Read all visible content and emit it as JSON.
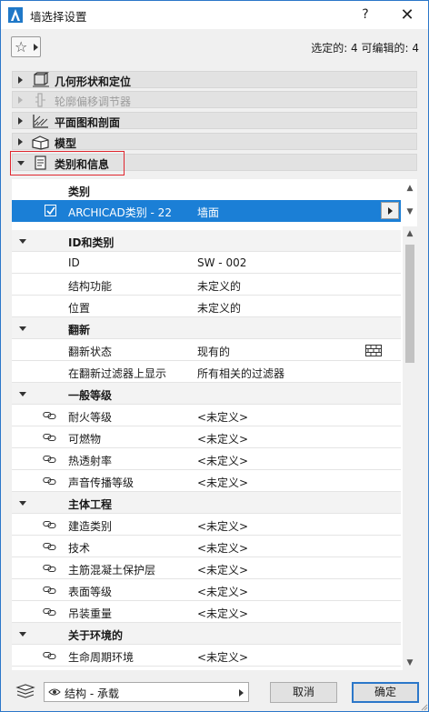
{
  "window": {
    "title": "墙选择设置",
    "help_label": "?",
    "close_label": "✕",
    "selection_info": "选定的: 4 可编辑的: 4"
  },
  "panels": [
    {
      "label": "几何形状和定位",
      "expanded": false,
      "enabled": true,
      "icon": "geometry-icon"
    },
    {
      "label": "轮廓偏移调节器",
      "expanded": false,
      "enabled": false,
      "icon": "offset-modifier-icon"
    },
    {
      "label": "平面图和剖面",
      "expanded": false,
      "enabled": true,
      "icon": "floorplan-section-icon"
    },
    {
      "label": "模型",
      "expanded": false,
      "enabled": true,
      "icon": "model-icon"
    },
    {
      "label": "类别和信息",
      "expanded": true,
      "enabled": true,
      "icon": "classification-icon"
    }
  ],
  "category": {
    "header": "类别",
    "name": "ARCHICAD类别 - 22",
    "value": "墙面"
  },
  "groups": {
    "id_cat": "ID和类别",
    "renovation": "翻新",
    "general": "一般等级",
    "structural": "主体工程",
    "environment": "关于环境的"
  },
  "props": {
    "id_label": "ID",
    "id_value": "SW - 002",
    "struct_func_label": "结构功能",
    "struct_func_value": "未定义的",
    "position_label": "位置",
    "position_value": "未定义的",
    "reno_status_label": "翻新状态",
    "reno_status_value": "现有的",
    "reno_filter_label": "在翻新过滤器上显示",
    "reno_filter_value": "所有相关的过滤器",
    "fire_label": "耐火等级",
    "fire_value": "<未定义>",
    "combust_label": "可燃物",
    "combust_value": "<未定义>",
    "thermal_label": "热透射率",
    "thermal_value": "<未定义>",
    "acoustic_label": "声音传播等级",
    "acoustic_value": "<未定义>",
    "build_cat_label": "建造类别",
    "build_cat_value": "<未定义>",
    "tech_label": "技术",
    "tech_value": "<未定义>",
    "cover_label": "主筋混凝土保护层",
    "cover_value": "<未定义>",
    "surface_label": "表面等级",
    "surface_value": "<未定义>",
    "lift_label": "吊装重量",
    "lift_value": "<未定义>",
    "lifecycle_label": "生命周期环境",
    "lifecycle_value": "<未定义>"
  },
  "footer": {
    "layer": "结构 - 承载",
    "cancel_label": "取消",
    "ok_label": "确定"
  },
  "colors": {
    "selection": "#1b7fd6",
    "highlight_box": "#e0262e",
    "default_button_border": "#2b77c9"
  }
}
